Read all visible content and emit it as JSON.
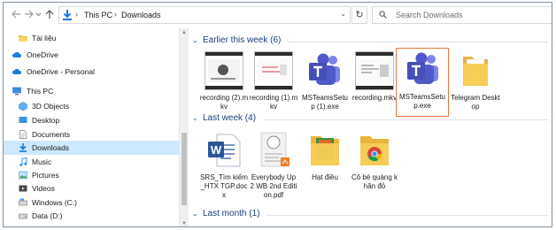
{
  "address_bar": {
    "back_icon": "arrow-left-icon",
    "forward_icon": "arrow-right-icon",
    "recent_icon": "chevron-down-icon",
    "up_icon": "arrow-up-icon",
    "breadcrumbs": [
      "This PC",
      "Downloads"
    ],
    "refresh_icon": "refresh-icon",
    "search_placeholder": "Search Downloads"
  },
  "nav": {
    "items": [
      {
        "label": "Tài liệu",
        "icon": "folder-icon",
        "selected": false
      },
      {
        "label": "OneDrive",
        "icon": "cloud-icon",
        "selected": false
      },
      {
        "label": "OneDrive - Personal",
        "icon": "cloud-icon",
        "selected": false
      },
      {
        "label": "This PC",
        "icon": "computer-icon",
        "selected": false
      },
      {
        "label": "3D Objects",
        "icon": "cube-icon",
        "selected": false
      },
      {
        "label": "Desktop",
        "icon": "desktop-icon",
        "selected": false
      },
      {
        "label": "Documents",
        "icon": "document-icon",
        "selected": false
      },
      {
        "label": "Downloads",
        "icon": "download-icon",
        "selected": true
      },
      {
        "label": "Music",
        "icon": "music-icon",
        "selected": false
      },
      {
        "label": "Pictures",
        "icon": "picture-icon",
        "selected": false
      },
      {
        "label": "Videos",
        "icon": "video-icon",
        "selected": false
      },
      {
        "label": "Windows (C:)",
        "icon": "drive-icon",
        "selected": false
      },
      {
        "label": "Data (D:)",
        "icon": "drive-icon",
        "selected": false
      }
    ]
  },
  "groups": [
    {
      "title": "Earlier this week (6)",
      "expanded": true
    },
    {
      "title": "Last week (4)",
      "expanded": true
    },
    {
      "title": "Last month (1)",
      "expanded": false
    }
  ],
  "files": {
    "earlier_this_week": [
      {
        "name": "recording (2).mkv",
        "icon": "video-file-icon"
      },
      {
        "name": "recording (1).mkv",
        "icon": "video-file-icon"
      },
      {
        "name": "MSTeamsSetup (1).exe",
        "icon": "teams-icon"
      },
      {
        "name": "recording.mkv",
        "icon": "video-file-icon"
      },
      {
        "name": "MSTeamsSetup.exe",
        "icon": "teams-icon",
        "selected": true
      },
      {
        "name": "Telegram Desktop",
        "icon": "folder-icon"
      }
    ],
    "last_week": [
      {
        "name": "SRS_Tìm kiếm_HTX TGP.docx",
        "icon": "word-icon"
      },
      {
        "name": "Everybody Up 2 WB 2nd Edition.pdf",
        "icon": "pdf-icon"
      },
      {
        "name": "Hạt điều",
        "icon": "folder-icon"
      },
      {
        "name": "Cô bé quàng khăn đỏ",
        "icon": "chrome-folder-icon"
      }
    ]
  },
  "colors": {
    "accent": "#1a5ea8",
    "selection_nav": "#cde8ff",
    "selection_tile_border": "#e8763a",
    "teams_purple": "#5059c9",
    "folder_yellow": "#f4c542"
  }
}
